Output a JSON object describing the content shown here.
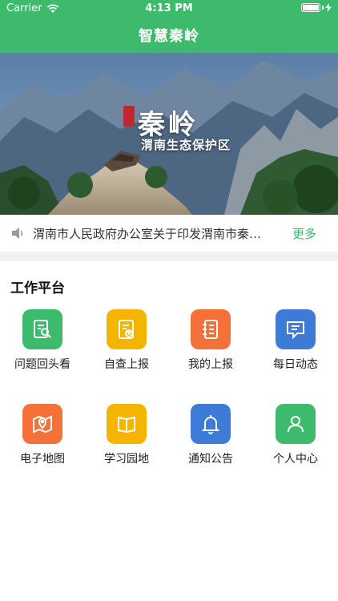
{
  "status_bar": {
    "carrier": "Carrier",
    "time": "4:13 PM"
  },
  "nav": {
    "title": "智慧秦岭"
  },
  "banner": {
    "title": "秦岭",
    "subtitle": "渭南生态保护区"
  },
  "notice": {
    "text": "渭南市人民政府办公室关于印发渭南市秦岭生态环境保护",
    "more": "更多"
  },
  "work_platform": {
    "title": "工作平台",
    "items": [
      {
        "label": "问题回头看",
        "icon": "search-document-icon",
        "color": "#3dba6b"
      },
      {
        "label": "自查上报",
        "icon": "upload-document-icon",
        "color": "#f5b400"
      },
      {
        "label": "我的上报",
        "icon": "notebook-icon",
        "color": "#f5713a"
      },
      {
        "label": "每日动态",
        "icon": "message-icon",
        "color": "#3d7bd6"
      },
      {
        "label": "电子地图",
        "icon": "map-pin-icon",
        "color": "#f5713a"
      },
      {
        "label": "学习园地",
        "icon": "book-icon",
        "color": "#f5b400"
      },
      {
        "label": "通知公告",
        "icon": "bell-icon",
        "color": "#3d7bd6"
      },
      {
        "label": "个人中心",
        "icon": "user-icon",
        "color": "#3dba6b"
      }
    ]
  }
}
